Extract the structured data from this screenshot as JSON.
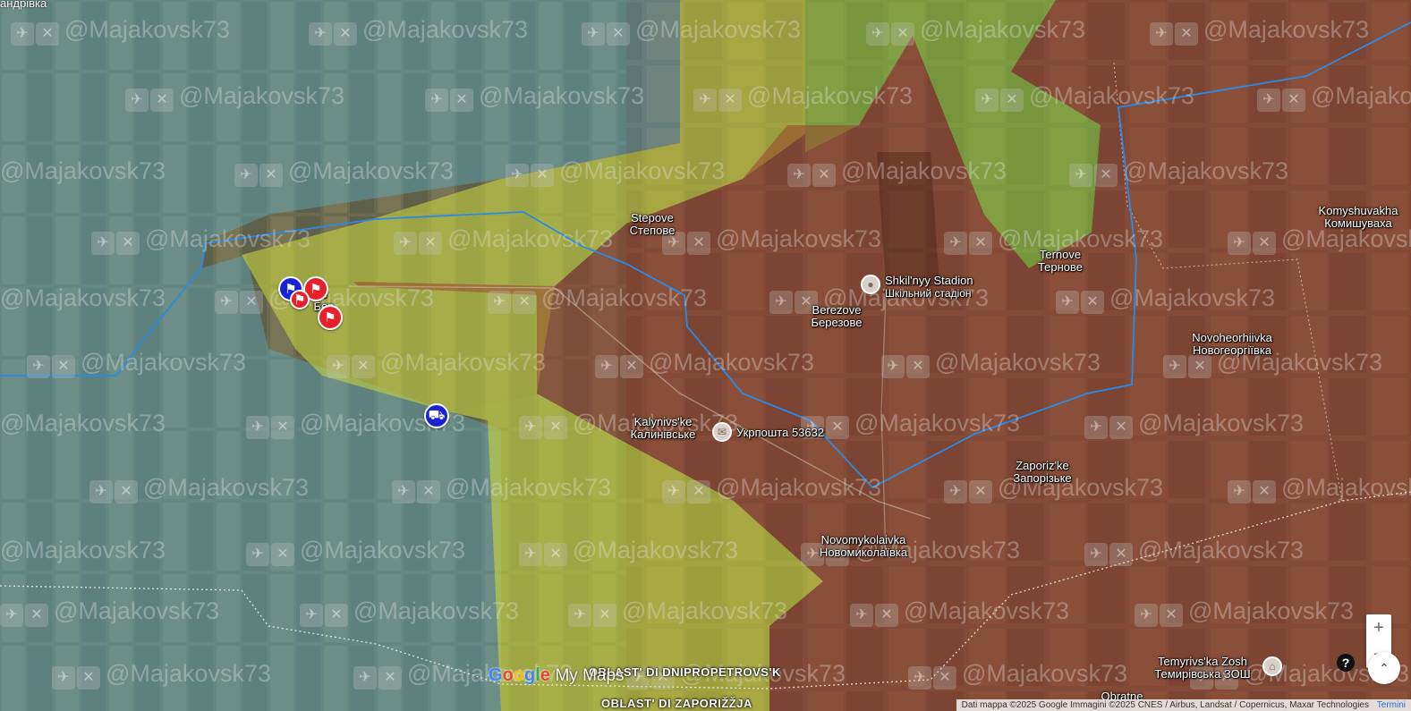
{
  "map": {
    "watermark_text": "@Majakovsk73",
    "corner_place": "андрівка",
    "places": [
      {
        "id": "stepove",
        "name": "Stepove",
        "name_local": "Степове"
      },
      {
        "id": "ternove",
        "name": "Ternove",
        "name_local": "Тернове"
      },
      {
        "id": "berezove",
        "name": "Berezove",
        "name_local": "Березове"
      },
      {
        "id": "komyshuvakha",
        "name": "Komyshuvakha",
        "name_local": "Комишуваха"
      },
      {
        "id": "novoheorhiivka",
        "name": "Novoheorhiivka",
        "name_local": "Новогеоргіївка"
      },
      {
        "id": "kalynivske",
        "name": "Kalynivs'ke",
        "name_local": "Калинівське"
      },
      {
        "id": "zaporizke",
        "name": "Zaporiz'ke",
        "name_local": "Запорізьке"
      },
      {
        "id": "novomykolaivka",
        "name": "Novomykolaivka",
        "name_local": "Новомиколаївка"
      },
      {
        "id": "temyrivska",
        "name": "Temyrivs'ka Zosh",
        "name_local": "Темирівська ЗОШ"
      },
      {
        "id": "obratne",
        "name": "Obratne",
        "name_local": ""
      }
    ],
    "partial_place": {
      "name": "e",
      "name_local": "Бер"
    },
    "pois": [
      {
        "id": "stadion",
        "name": "Shkil'nyy Stadion",
        "name_local": "Шкільний стадіон",
        "icon": "pin-icon"
      },
      {
        "id": "ukrposhta",
        "name": "Укрпошта 53632",
        "icon": "mail-icon"
      }
    ],
    "oblast_labels": [
      "OBLAST' DI DNIPROPETROVS'K",
      "OBLAST' DI ZAPORIŽŽJA"
    ],
    "colors": {
      "ukraine_zone": "#5fb0c8",
      "contested_zone": "#c8d640",
      "russia_zone": "#9a3a2a",
      "green_zone": "#8ad040",
      "frontline": "#2a8ae8",
      "marker_red": "#e8202a",
      "marker_blue": "#1a22d8"
    },
    "markers": [
      {
        "id": "flag-blue",
        "type": "flag",
        "color": "blue"
      },
      {
        "id": "flag-red-1",
        "type": "flag",
        "color": "red"
      },
      {
        "id": "flag-red-2",
        "type": "flag",
        "color": "red"
      },
      {
        "id": "flag-red-3",
        "type": "flag",
        "color": "red"
      },
      {
        "id": "vehicle-blue",
        "type": "burning-vehicle",
        "color": "blue"
      }
    ]
  },
  "controls": {
    "zoom_in": "+",
    "zoom_out": "−",
    "help": "?",
    "compass": "⌃"
  },
  "branding": {
    "google": [
      "G",
      "o",
      "o",
      "g",
      "l",
      "e"
    ],
    "product": "My Maps"
  },
  "attribution": {
    "text": "Dati mappa ©2025 Google Immagini ©2025 CNES / Airbus, Landsat / Copernicus, Maxar Technologies",
    "terms": "Termini"
  }
}
